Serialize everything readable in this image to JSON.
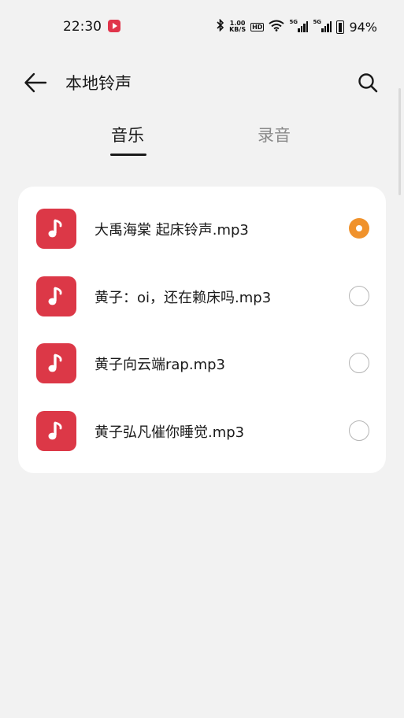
{
  "status_bar": {
    "time": "22:30",
    "net_speed_value": "1.00",
    "net_speed_unit": "KB/S",
    "hd_label": "HD",
    "signal1_tag": "5G",
    "signal2_tag": "5G",
    "battery_percent": "94%"
  },
  "header": {
    "title": "本地铃声"
  },
  "tabs": [
    {
      "label": "音乐",
      "active": true
    },
    {
      "label": "录音",
      "active": false
    }
  ],
  "ringtones": [
    {
      "name": "大禹海棠 起床铃声.mp3",
      "selected": true
    },
    {
      "name": "黄子：oi，还在赖床吗.mp3",
      "selected": false
    },
    {
      "name": "黄子向云端rap.mp3",
      "selected": false
    },
    {
      "name": "黄子弘凡催你睡觉.mp3",
      "selected": false
    }
  ],
  "colors": {
    "accent": "#f0922c",
    "icon_bg": "#dc3847",
    "background": "#f2f2f2"
  }
}
